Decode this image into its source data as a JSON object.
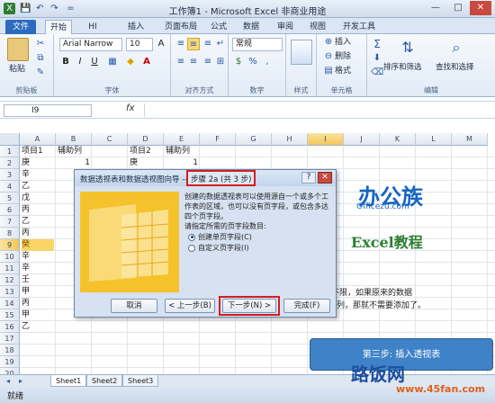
{
  "window": {
    "title": "工作簿1 - Microsoft Excel 非商业用途",
    "minimize": "—",
    "maximize": "□",
    "close": "✕"
  },
  "quick_access": [
    "X",
    "💾",
    "↶",
    "↷",
    "="
  ],
  "ribbon_tabs": [
    "文件",
    "开始",
    "HI",
    "插入",
    "页面布局",
    "公式",
    "数据",
    "审阅",
    "视图",
    "开发工具"
  ],
  "clipboard": {
    "paste": "粘贴",
    "label": "剪贴板"
  },
  "font": {
    "name": "Arial Narrow",
    "size": "10",
    "bold": "B",
    "italic": "I",
    "underline": "U",
    "label": "字体",
    "grow": "A",
    "shrink": "A"
  },
  "alignment": {
    "label": "对齐方式"
  },
  "number": {
    "format": "常规",
    "percent": "%",
    "comma": ",",
    "currency": "$",
    "label": "数字"
  },
  "styles": {
    "label": "样式"
  },
  "cells": {
    "insert": "插入",
    "delete": "删除",
    "format": "格式",
    "label": "单元格"
  },
  "editing": {
    "sum": "Σ",
    "sort": "排序和筛选",
    "find": "查找和选择",
    "label": "编辑"
  },
  "formula_bar": {
    "name_box": "I9",
    "fx": "fx",
    "value": ""
  },
  "columns": [
    "A",
    "B",
    "C",
    "D",
    "E",
    "F",
    "G",
    "H",
    "I",
    "J",
    "K",
    "L",
    "M"
  ],
  "rows": [
    "1",
    "2",
    "3",
    "4",
    "5",
    "6",
    "7",
    "8",
    "9",
    "10",
    "11",
    "12",
    "13",
    "14",
    "15",
    "16",
    "17",
    "18",
    "19",
    "20"
  ],
  "cells_data": {
    "A": [
      "项目1",
      "庚",
      "辛",
      "乙",
      "戊",
      "丙",
      "乙",
      "丙",
      "癸",
      "辛",
      "辛",
      "壬",
      "甲",
      "丙",
      "甲",
      "乙",
      "",
      "",
      "",
      ""
    ],
    "B": [
      "辅助列",
      "1",
      "",
      "",
      "",
      "",
      "",
      "",
      "",
      "",
      "",
      "",
      "",
      "",
      "",
      "",
      "",
      "",
      "",
      ""
    ],
    "D": [
      "项目2",
      "庚",
      "",
      "",
      "",
      "",
      "",
      "",
      "",
      "",
      "",
      "",
      "",
      "",
      "",
      "",
      "",
      "",
      "",
      ""
    ],
    "E": [
      "辅助列",
      "1",
      "",
      "",
      "",
      "",
      "",
      "",
      "",
      "",
      "",
      "",
      "",
      "",
      "",
      "",
      "",
      "",
      "",
      ""
    ]
  },
  "right_text": {
    "line1": "内容不限，如果原来的数据",
    "line2": "列，那就不需要添加了。"
  },
  "sheet_tabs": [
    "Sheet1",
    "Sheet2",
    "Sheet3"
  ],
  "status": {
    "ready": "就绪"
  },
  "dialog": {
    "title": "数据透视表和数据透视图向导 --",
    "step": "步骤 2a (共 3 步)",
    "help": "?",
    "close": "✕",
    "description": "创建的数据透视表可以使用源自一个或多个工作表的区域，也可以没有页字段，或包含多达四个页字段。",
    "prompt": "请指定所需的页字段数目:",
    "options": [
      "创建单页字段(C)",
      "自定义页字段(I)"
    ],
    "selected": 0,
    "buttons": {
      "cancel": "取消",
      "back": "< 上一步(B)",
      "next": "下一步(N) >",
      "finish": "完成(F)"
    }
  },
  "brand": {
    "logo": "办公族",
    "logo_sub": "Officezu.com",
    "excel": "Excel教程"
  },
  "step_box": "第三步: 插入透视表",
  "watermark": {
    "cn": "路饭网",
    "url": "www.45fan.com"
  }
}
